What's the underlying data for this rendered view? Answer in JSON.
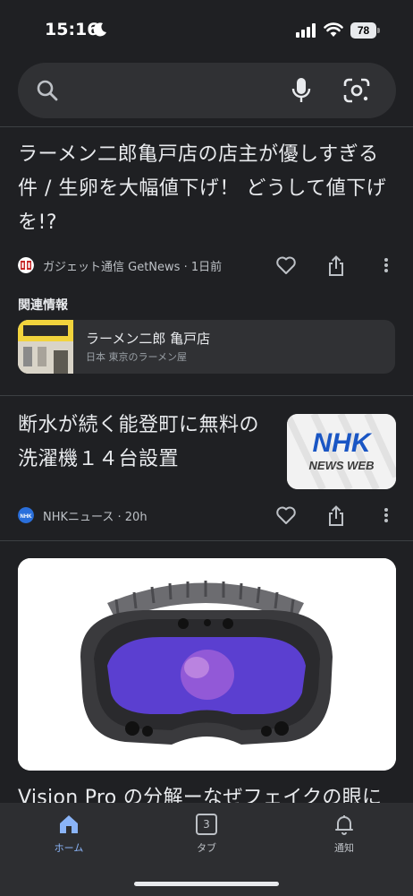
{
  "status_bar": {
    "time": "15:16",
    "battery": "78"
  },
  "search": {
    "placeholder": ""
  },
  "articles": [
    {
      "title": "ラーメン二郎亀戸店の店主が優しすぎる件 / 生卵を大幅値下げ！ どうして値下げを!?",
      "source": "ガジェット通信 GetNews",
      "age": "1日前",
      "related": {
        "label": "関連情報",
        "title": "ラーメン二郎 亀戸店",
        "subtitle": "日本 東京のラーメン屋"
      }
    },
    {
      "title": "断水が続く能登町に無料の洗濯機１４台設置",
      "source": "NHKニュース",
      "age": "20h",
      "thumb_text": {
        "main": "NHK",
        "sub": "NEWS WEB"
      }
    },
    {
      "title": "Vision Pro の分解ーなぜフェイクの眼に"
    }
  ],
  "nav": {
    "home": "ホーム",
    "tabs": "タブ",
    "tabs_count": "3",
    "notifications": "通知"
  },
  "colors": {
    "accent": "#8ab4f8",
    "background": "#1f2023",
    "card": "#303134"
  }
}
